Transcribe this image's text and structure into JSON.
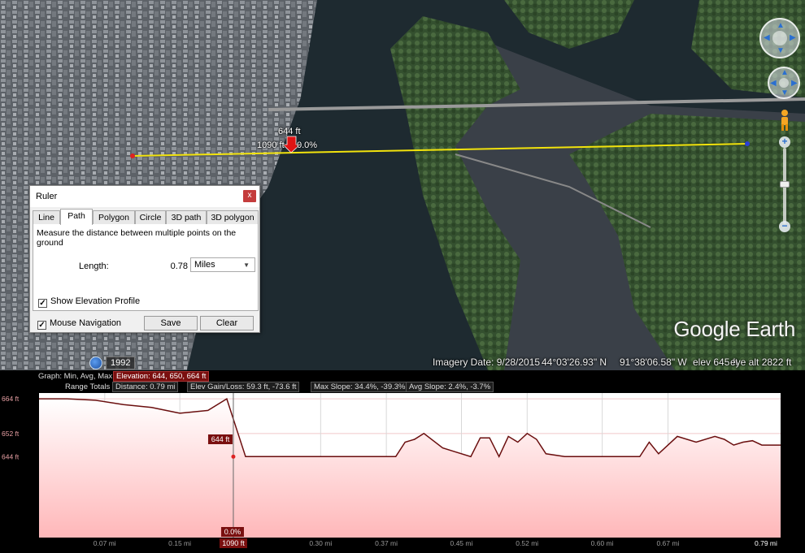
{
  "map": {
    "path_point_elev": "644 ft",
    "path_point_dist": "1090 ft",
    "path_point_slope": "0.0%",
    "history_year": "1992",
    "logo_google": "Google",
    "logo_earth": "Earth",
    "status": {
      "imagery_date": "Imagery Date: 9/28/2015",
      "lat": "44°03'26.93\" N",
      "lon": "91°38'06.58\" W",
      "elev": "elev  645 ft",
      "eye_alt": "eye alt  2822 ft"
    },
    "colors": {
      "path_line": "#f2e30c",
      "water": "#1e2a30",
      "land": "#3f5a38"
    }
  },
  "ruler": {
    "title": "Ruler",
    "close_label": "x",
    "tabs": [
      "Line",
      "Path",
      "Polygon",
      "Circle",
      "3D path",
      "3D polygon"
    ],
    "active_tab": "Path",
    "description": "Measure the distance between multiple points on the ground",
    "length_label": "Length:",
    "length_value": "0.78",
    "units_selected": "Miles",
    "show_elevation_profile": "Show Elevation Profile",
    "mouse_navigation": "Mouse Navigation",
    "save_label": "Save",
    "clear_label": "Clear"
  },
  "profile": {
    "graph_label": "Graph: Min, Avg, Max",
    "elevation_box": "Elevation: 644, 650, 664 ft",
    "range_label": "Range Totals",
    "distance_box": "Distance: 0.79 mi",
    "gain_box": "Elev Gain/Loss: 59.3 ft, -73.6 ft",
    "max_slope_box": "Max Slope: 34.4%, -39.3%",
    "avg_slope_box": "Avg Slope: 2.4%, -3.7%",
    "cursor_elev": "644 ft",
    "cursor_slope": "0.0%",
    "cursor_dist": "1090 ft",
    "y_ticks": [
      "664 ft",
      "652 ft",
      "644 ft"
    ],
    "x_ticks": [
      "0.07 mi",
      "0.15 mi",
      "0.30 mi",
      "0.37 mi",
      "0.45 mi",
      "0.52 mi",
      "0.60 mi",
      "0.67 mi",
      "0.79 mi"
    ],
    "colors": {
      "fill_top": "#ffffff",
      "fill_bottom": "#ffb7b9",
      "line": "#6a0e0e",
      "label_bg": "#7a0f0f"
    }
  },
  "chart_data": {
    "type": "area",
    "x": [
      0,
      0.03,
      0.06,
      0.09,
      0.12,
      0.15,
      0.18,
      0.2,
      0.21,
      0.22,
      0.24,
      0.26,
      0.3,
      0.35,
      0.38,
      0.39,
      0.4,
      0.41,
      0.43,
      0.44,
      0.46,
      0.47,
      0.48,
      0.49,
      0.5,
      0.51,
      0.52,
      0.53,
      0.54,
      0.56,
      0.58,
      0.6,
      0.62,
      0.64,
      0.65,
      0.66,
      0.67,
      0.68,
      0.7,
      0.72,
      0.73,
      0.74,
      0.75,
      0.76,
      0.77,
      0.79
    ],
    "y": [
      664,
      664,
      663.5,
      662,
      661,
      659,
      660,
      664,
      654,
      644,
      644,
      644,
      644,
      644,
      644,
      649,
      650,
      652,
      647,
      646,
      644,
      650.5,
      650.5,
      644,
      651,
      649,
      652,
      650,
      645,
      644,
      644,
      644,
      644,
      644,
      649,
      645,
      648,
      651,
      649,
      651,
      650,
      648,
      649,
      649.5,
      648,
      648
    ],
    "xlim": [
      0,
      0.79
    ],
    "ylim": [
      616,
      666
    ],
    "cursor_x": 0.207,
    "grid": true
  }
}
